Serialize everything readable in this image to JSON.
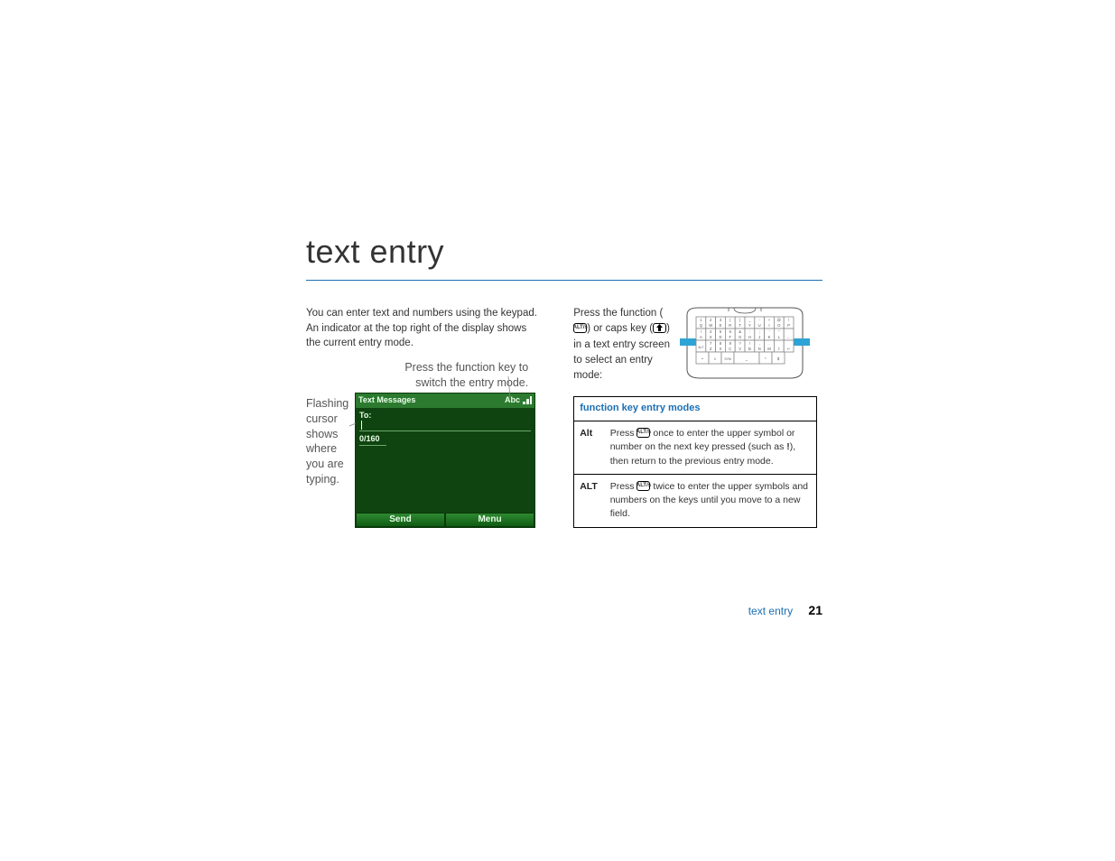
{
  "page": {
    "title": "text entry",
    "section_label": "text entry",
    "page_number": "21"
  },
  "left": {
    "intro": "You can enter text and numbers using the keypad. An indicator at the top right of the display shows the current entry mode.",
    "callout_top_line1": "Press the function key to",
    "callout_top_line2": "switch the entry mode.",
    "cursor_label": "Flashing cursor shows where you are typing.",
    "phone": {
      "title": "Text Messages",
      "mode": "Abc",
      "to_label": "To:",
      "count": "0/160",
      "softkey_left": "Send",
      "softkey_right": "Menu"
    }
  },
  "right": {
    "intro_parts": {
      "p1": "Press the function (",
      "p2": ") or caps key (",
      "p3": ") in a text entry screen to select an entry mode:"
    },
    "alt_key_label": "ALT/s",
    "table": {
      "header": "function key entry modes",
      "rows": [
        {
          "label": "Alt",
          "before": "Press ",
          "after": " once to enter the upper symbol or number on the next key pressed (such as ",
          "suffix": "!",
          "after2": "), then return to the previous entry mode."
        },
        {
          "label": "ALT",
          "before": "Press ",
          "after": " twice to enter the upper symbols and numbers on the keys until you move to a new field.",
          "suffix": "",
          "after2": ""
        }
      ]
    }
  }
}
